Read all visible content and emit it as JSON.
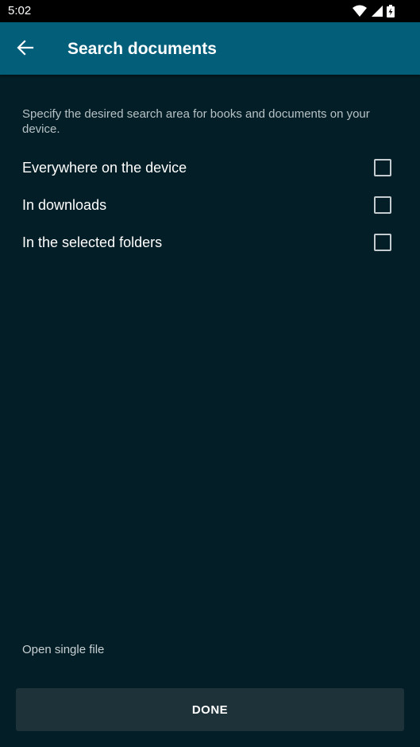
{
  "status_bar": {
    "time": "5:02",
    "icons": [
      "wifi-icon",
      "cell-signal-icon",
      "battery-charging-icon"
    ]
  },
  "app_bar": {
    "back_icon": "arrow-left-icon",
    "title": "Search documents"
  },
  "content": {
    "description": "Specify the desired search area for books and documents on your device.",
    "options": [
      {
        "label": "Everywhere on the device",
        "checked": false
      },
      {
        "label": "In downloads",
        "checked": false
      },
      {
        "label": "In the selected folders",
        "checked": false
      }
    ],
    "open_single_file": "Open single file",
    "done_label": "DONE"
  },
  "colors": {
    "background": "#031e26",
    "app_bar": "#035e79",
    "status_bar": "#000000",
    "button": "#1e323a"
  }
}
